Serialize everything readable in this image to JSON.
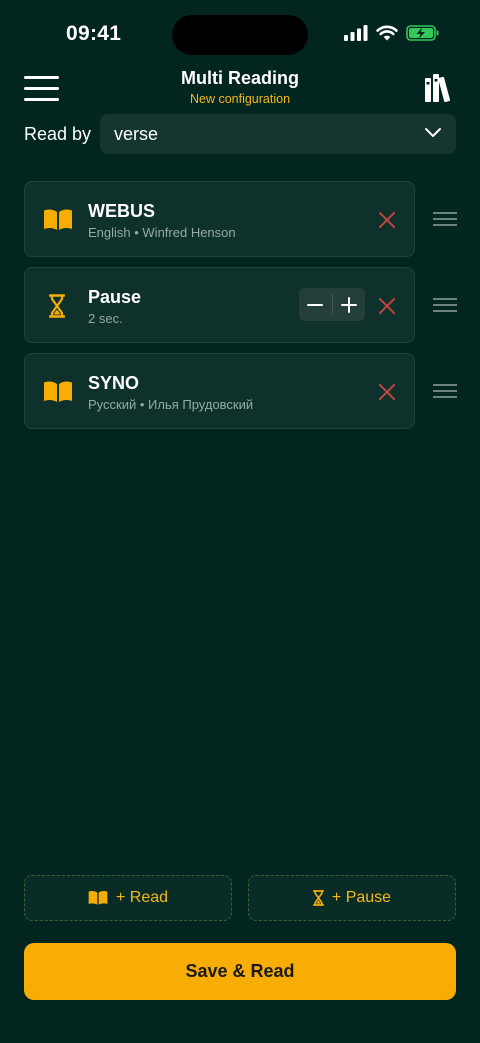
{
  "status_bar": {
    "time": "09:41"
  },
  "header": {
    "title": "Multi Reading",
    "subtitle": "New configuration"
  },
  "read_by": {
    "label": "Read by",
    "value": "verse"
  },
  "items": [
    {
      "type": "read",
      "title": "WEBUS",
      "language": "English",
      "author": "Winfred Henson",
      "subtitle": "English • Winfred Henson"
    },
    {
      "type": "pause",
      "title": "Pause",
      "subtitle": "2 sec."
    },
    {
      "type": "read",
      "title": "SYNO",
      "language": "Русский",
      "author": "Илья Прудовский",
      "subtitle": "Русский • Илья Прудовский"
    }
  ],
  "actions": {
    "add_read_label": "+ Read",
    "add_pause_label": "+ Pause",
    "save_label": "Save & Read"
  },
  "colors": {
    "background": "#032520",
    "card": "#0f312b",
    "accent": "#f8ad04",
    "remove": "#c0443e",
    "battery": "#34c759"
  }
}
